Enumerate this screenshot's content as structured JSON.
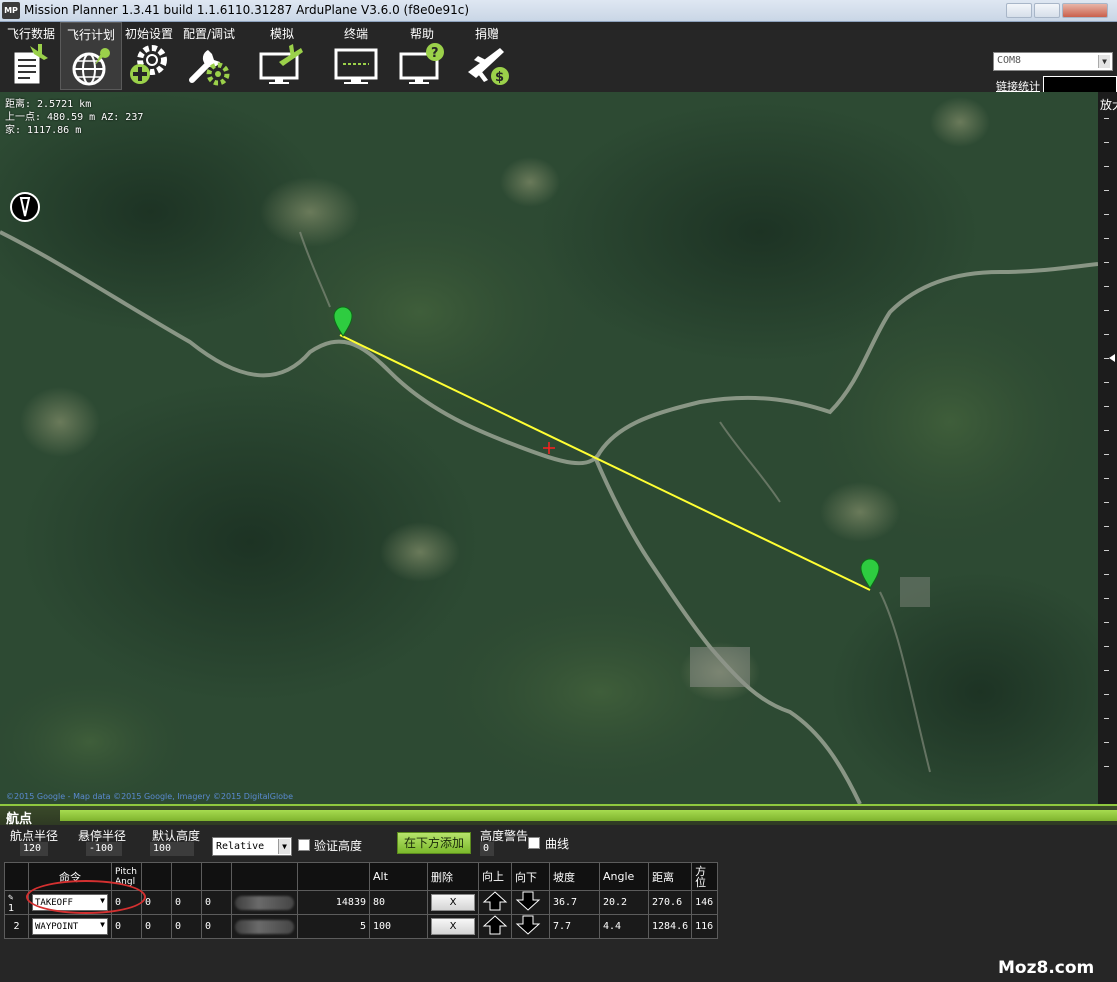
{
  "window": {
    "title": "Mission Planner 1.3.41 build 1.1.6110.31287 ArduPlane V3.6.0 (f8e0e91c)",
    "icon_text": "MP"
  },
  "menu": {
    "items": [
      {
        "label": "飞行数据",
        "icon": "flight-data-icon"
      },
      {
        "label": "飞行计划",
        "icon": "flight-plan-icon",
        "active": true
      },
      {
        "label": "初始设置",
        "icon": "initial-setup-icon"
      },
      {
        "label": "配置/调试",
        "icon": "config-tuning-icon"
      },
      {
        "label": "模拟",
        "icon": "simulation-icon"
      },
      {
        "label": "终端",
        "icon": "terminal-icon"
      },
      {
        "label": "帮助",
        "icon": "help-icon"
      },
      {
        "label": "捐赠",
        "icon": "donate-icon"
      }
    ],
    "com_port": "COM8",
    "link_stats": "链接统计"
  },
  "map": {
    "info": {
      "distance": "距离: 2.5721 km",
      "prev_point": "上一点: 480.59 m AZ: 237",
      "home": "家: 1117.86 m"
    },
    "copyright": "©2015 Google - Map data ©2015 Google, Imagery ©2015 DigitalGlobe",
    "zoom_label": "放大",
    "route_color": "#ffff33",
    "marker_color": "#2ecc40"
  },
  "waypoints": {
    "header": "航点",
    "params": {
      "wp_radius_label": "航点半径",
      "wp_radius": "120",
      "loiter_radius_label": "悬停半径",
      "loiter_radius": "-100",
      "default_alt_label": "默认高度",
      "default_alt": "100",
      "alt_mode": "Relative",
      "verify_height_label": "验证高度",
      "add_below_label": "在下方添加",
      "alt_warn_label": "高度警告",
      "alt_warn": "0",
      "spline_label": "曲线"
    },
    "columns": [
      "",
      "命令",
      "Pitch Angl",
      "",
      "",
      "",
      "",
      "",
      "Alt",
      "删除",
      "向上",
      "向下",
      "坡度",
      "Angle",
      "距离",
      "方位"
    ],
    "rows": [
      {
        "num": "1",
        "command": "TAKEOFF",
        "p1": "0",
        "p2": "0",
        "p3": "0",
        "p4": "0",
        "lon": "14839",
        "alt": "80",
        "delete": "X",
        "grad": "36.7",
        "angle": "20.2",
        "dist": "270.6",
        "az": "146"
      },
      {
        "num": "2",
        "command": "WAYPOINT",
        "p1": "0",
        "p2": "0",
        "p3": "0",
        "p4": "0",
        "lon": "5",
        "alt": "100",
        "delete": "X",
        "grad": "7.7",
        "angle": "4.4",
        "dist": "1284.6",
        "az": "116"
      }
    ]
  },
  "watermark": "Moz8.com"
}
